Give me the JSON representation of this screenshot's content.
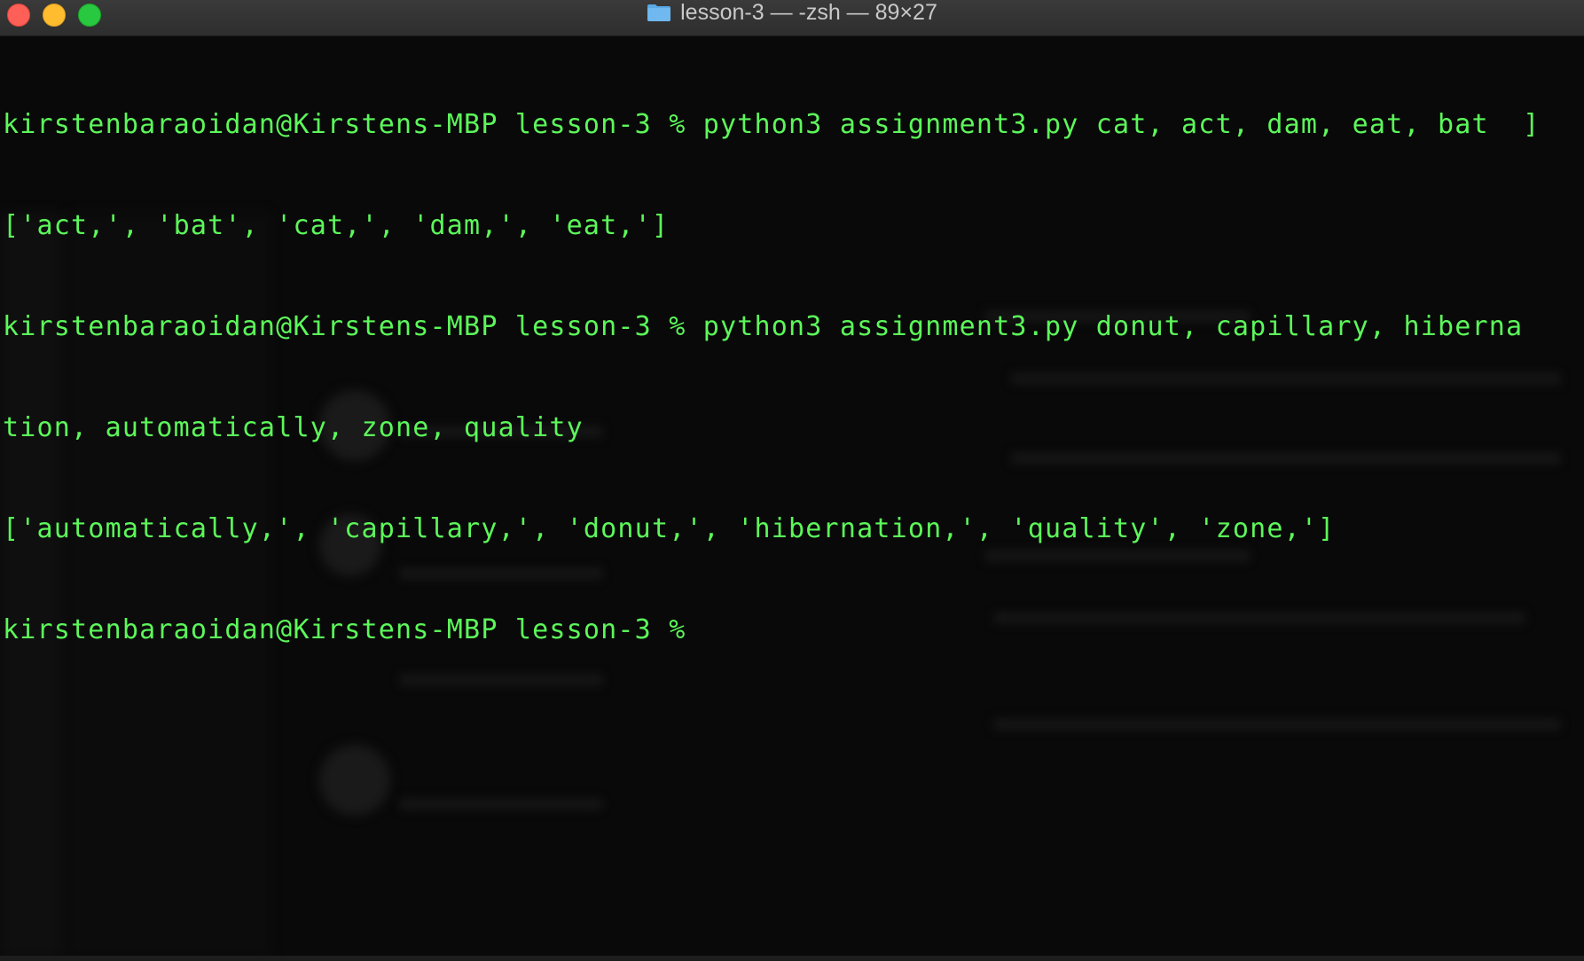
{
  "window": {
    "title": "lesson-3 — -zsh — 89×27",
    "title_icon": "folder-icon",
    "colors": {
      "close": "#fe5f57",
      "minimize": "#febc2e",
      "maximize": "#28c840",
      "terminal_text": "#5cf75a",
      "background": "#090909"
    }
  },
  "terminal": {
    "lines": [
      "kirstenbaraoidan@Kirstens-MBP lesson-3 % python3 assignment3.py cat, act, dam, eat, bat  ]",
      "['act,', 'bat', 'cat,', 'dam,', 'eat,']",
      "kirstenbaraoidan@Kirstens-MBP lesson-3 % python3 assignment3.py donut, capillary, hiberna",
      "tion, automatically, zone, quality",
      "['automatically,', 'capillary,', 'donut,', 'hibernation,', 'quality', 'zone,']",
      "kirstenbaraoidan@Kirstens-MBP lesson-3 % "
    ]
  }
}
